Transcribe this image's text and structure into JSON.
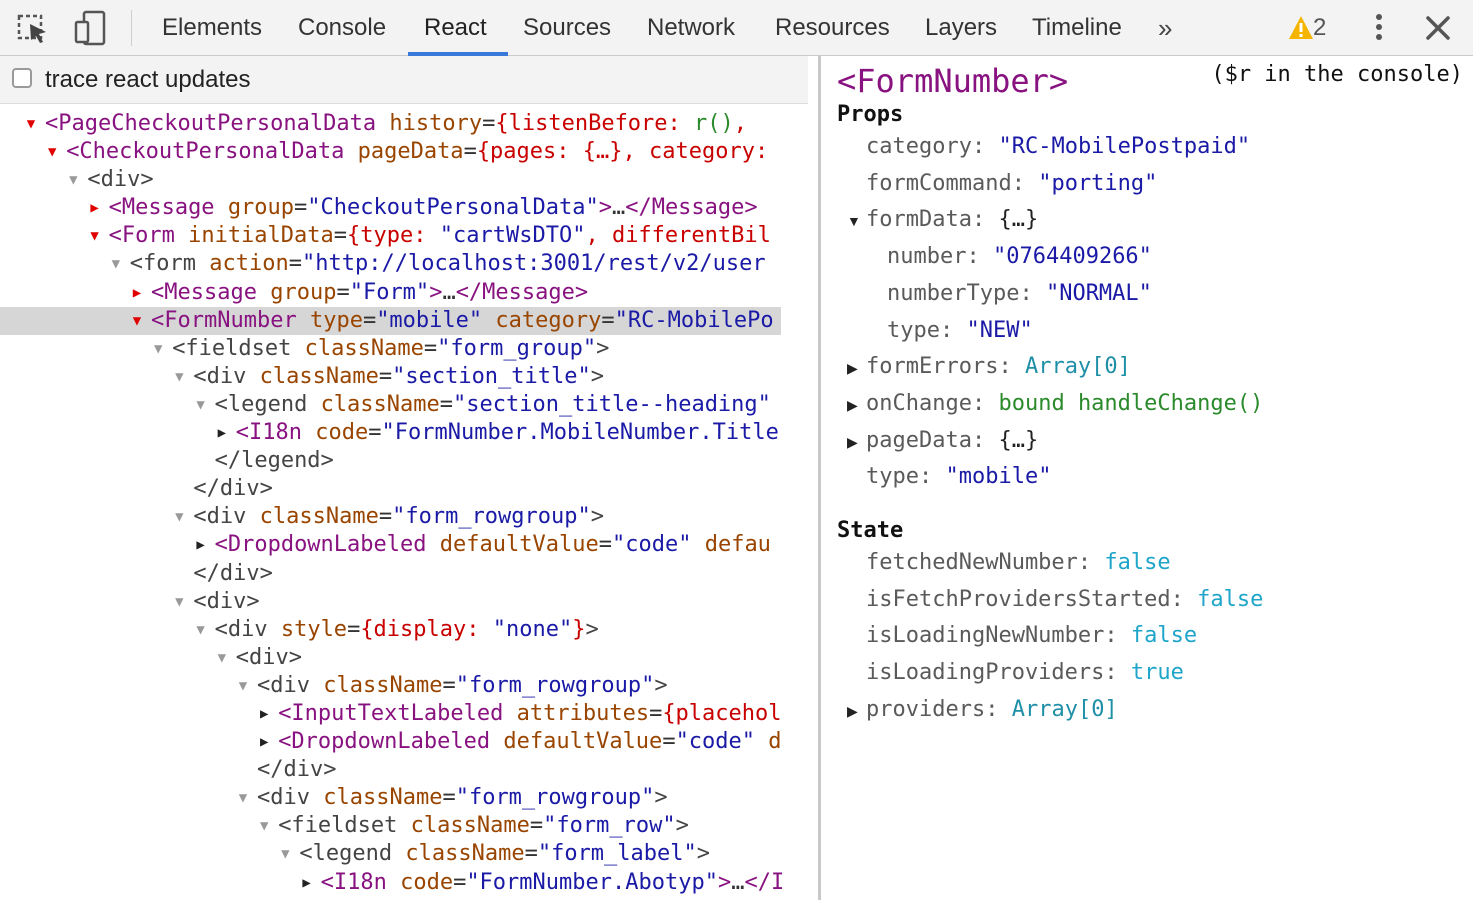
{
  "toolbar": {
    "tabs": [
      "Elements",
      "Console",
      "React",
      "Sources",
      "Network",
      "Resources",
      "Layers",
      "Timeline"
    ],
    "active_tab": "React",
    "more_tabs_glyph": "»",
    "warning_count": "2",
    "icons": [
      "inspect-element-icon",
      "device-mode-icon",
      "warning-icon",
      "kebab-menu-icon",
      "close-icon"
    ],
    "colors": {
      "active_underline": "#3879d9",
      "warning": "#f4b400"
    }
  },
  "left": {
    "trace_label": "trace react updates",
    "trace_checked": false,
    "tree": [
      {
        "indent": 0,
        "tri": "open",
        "parts": [
          [
            "tag",
            "<PageCheckoutPersonalData"
          ],
          [
            "tok",
            " "
          ],
          [
            "attr",
            "history"
          ],
          [
            "eq",
            "="
          ],
          [
            "obj",
            "{listenBefore: "
          ],
          [
            "func",
            "r()"
          ],
          [
            "obj",
            ", "
          ]
        ]
      },
      {
        "indent": 1,
        "tri": "open",
        "parts": [
          [
            "tag",
            "<CheckoutPersonalData"
          ],
          [
            "tok",
            " "
          ],
          [
            "attr",
            "pageData"
          ],
          [
            "eq",
            "="
          ],
          [
            "obj",
            "{pages: {…}, category:"
          ]
        ]
      },
      {
        "indent": 2,
        "tri": "open-grey",
        "parts": [
          [
            "tagplain",
            "<div>"
          ]
        ]
      },
      {
        "indent": 3,
        "tri": "closed",
        "parts": [
          [
            "tag",
            "<Message"
          ],
          [
            "tok",
            " "
          ],
          [
            "attr",
            "group"
          ],
          [
            "eq",
            "="
          ],
          [
            "str",
            "\"CheckoutPersonalData\""
          ],
          [
            "tag",
            ">"
          ],
          [
            "tok",
            "…"
          ],
          [
            "tag",
            "</Message>"
          ]
        ]
      },
      {
        "indent": 3,
        "tri": "open",
        "parts": [
          [
            "tag",
            "<Form"
          ],
          [
            "tok",
            " "
          ],
          [
            "attr",
            "initialData"
          ],
          [
            "eq",
            "="
          ],
          [
            "obj",
            "{type: "
          ],
          [
            "str",
            "\"cartWsDTO\""
          ],
          [
            "obj",
            ", differentBil"
          ]
        ]
      },
      {
        "indent": 4,
        "tri": "open-grey",
        "parts": [
          [
            "tagplain",
            "<form"
          ],
          [
            "tok",
            " "
          ],
          [
            "attr",
            "action"
          ],
          [
            "eq",
            "="
          ],
          [
            "str",
            "\"http://localhost:3001/rest/v2/user"
          ]
        ]
      },
      {
        "indent": 5,
        "tri": "closed",
        "parts": [
          [
            "tag",
            "<Message"
          ],
          [
            "tok",
            " "
          ],
          [
            "attr",
            "group"
          ],
          [
            "eq",
            "="
          ],
          [
            "str",
            "\"Form\""
          ],
          [
            "tag",
            ">"
          ],
          [
            "tok",
            "…"
          ],
          [
            "tag",
            "</Message>"
          ]
        ]
      },
      {
        "indent": 5,
        "tri": "open",
        "selected": true,
        "parts": [
          [
            "tag",
            "<FormNumber"
          ],
          [
            "tok",
            " "
          ],
          [
            "attr",
            "type"
          ],
          [
            "eq",
            "="
          ],
          [
            "str",
            "\"mobile\""
          ],
          [
            "tok",
            " "
          ],
          [
            "attr",
            "category"
          ],
          [
            "eq",
            "="
          ],
          [
            "str",
            "\"RC-MobilePo"
          ]
        ]
      },
      {
        "indent": 6,
        "tri": "open-grey",
        "parts": [
          [
            "tagplain",
            "<fieldset"
          ],
          [
            "tok",
            " "
          ],
          [
            "attr",
            "className"
          ],
          [
            "eq",
            "="
          ],
          [
            "str",
            "\"form_group\""
          ],
          [
            "tagplain",
            ">"
          ]
        ]
      },
      {
        "indent": 7,
        "tri": "open-grey",
        "parts": [
          [
            "tagplain",
            "<div"
          ],
          [
            "tok",
            " "
          ],
          [
            "attr",
            "className"
          ],
          [
            "eq",
            "="
          ],
          [
            "str",
            "\"section_title\""
          ],
          [
            "tagplain",
            ">"
          ]
        ]
      },
      {
        "indent": 8,
        "tri": "open-grey",
        "parts": [
          [
            "tagplain",
            "<legend"
          ],
          [
            "tok",
            " "
          ],
          [
            "attr",
            "className"
          ],
          [
            "eq",
            "="
          ],
          [
            "str",
            "\"section_title--heading\""
          ]
        ]
      },
      {
        "indent": 9,
        "tri": "closed",
        "parts": [
          [
            "tag",
            "<I18n"
          ],
          [
            "tok",
            " "
          ],
          [
            "attr",
            "code"
          ],
          [
            "eq",
            "="
          ],
          [
            "str",
            "\"FormNumber.MobileNumber.Title"
          ]
        ]
      },
      {
        "indent": 8,
        "tri": "none",
        "parts": [
          [
            "tagplain",
            "</legend>"
          ]
        ]
      },
      {
        "indent": 7,
        "tri": "none",
        "parts": [
          [
            "tagplain",
            "</div>"
          ]
        ]
      },
      {
        "indent": 7,
        "tri": "open-grey",
        "parts": [
          [
            "tagplain",
            "<div"
          ],
          [
            "tok",
            " "
          ],
          [
            "attr",
            "className"
          ],
          [
            "eq",
            "="
          ],
          [
            "str",
            "\"form_rowgroup\""
          ],
          [
            "tagplain",
            ">"
          ]
        ]
      },
      {
        "indent": 8,
        "tri": "closed",
        "parts": [
          [
            "tag",
            "<DropdownLabeled"
          ],
          [
            "tok",
            " "
          ],
          [
            "attr",
            "defaultValue"
          ],
          [
            "eq",
            "="
          ],
          [
            "str",
            "\"code\""
          ],
          [
            "tok",
            " "
          ],
          [
            "attr",
            "defau"
          ]
        ]
      },
      {
        "indent": 7,
        "tri": "none",
        "parts": [
          [
            "tagplain",
            "</div>"
          ]
        ]
      },
      {
        "indent": 7,
        "tri": "open-grey",
        "parts": [
          [
            "tagplain",
            "<div>"
          ]
        ]
      },
      {
        "indent": 8,
        "tri": "open-grey",
        "parts": [
          [
            "tagplain",
            "<div"
          ],
          [
            "tok",
            " "
          ],
          [
            "attr",
            "style"
          ],
          [
            "eq",
            "="
          ],
          [
            "obj",
            "{display: "
          ],
          [
            "str",
            "\"none\""
          ],
          [
            "obj",
            "}"
          ],
          [
            "tagplain",
            ">"
          ]
        ]
      },
      {
        "indent": 9,
        "tri": "open-grey",
        "parts": [
          [
            "tagplain",
            "<div>"
          ]
        ]
      },
      {
        "indent": 10,
        "tri": "open-grey",
        "parts": [
          [
            "tagplain",
            "<div"
          ],
          [
            "tok",
            " "
          ],
          [
            "attr",
            "className"
          ],
          [
            "eq",
            "="
          ],
          [
            "str",
            "\"form_rowgroup\""
          ],
          [
            "tagplain",
            ">"
          ]
        ]
      },
      {
        "indent": 11,
        "tri": "closed",
        "parts": [
          [
            "tag",
            "<InputTextLabeled"
          ],
          [
            "tok",
            " "
          ],
          [
            "attr",
            "attributes"
          ],
          [
            "eq",
            "="
          ],
          [
            "obj",
            "{placehol"
          ]
        ]
      },
      {
        "indent": 11,
        "tri": "closed",
        "parts": [
          [
            "tag",
            "<DropdownLabeled"
          ],
          [
            "tok",
            " "
          ],
          [
            "attr",
            "defaultValue"
          ],
          [
            "eq",
            "="
          ],
          [
            "str",
            "\"code\""
          ],
          [
            "tok",
            " "
          ],
          [
            "attr",
            "d"
          ]
        ]
      },
      {
        "indent": 10,
        "tri": "none",
        "parts": [
          [
            "tagplain",
            "</div>"
          ]
        ]
      },
      {
        "indent": 10,
        "tri": "open-grey",
        "parts": [
          [
            "tagplain",
            "<div"
          ],
          [
            "tok",
            " "
          ],
          [
            "attr",
            "className"
          ],
          [
            "eq",
            "="
          ],
          [
            "str",
            "\"form_rowgroup\""
          ],
          [
            "tagplain",
            ">"
          ]
        ]
      },
      {
        "indent": 11,
        "tri": "open-grey",
        "parts": [
          [
            "tagplain",
            "<fieldset"
          ],
          [
            "tok",
            " "
          ],
          [
            "attr",
            "className"
          ],
          [
            "eq",
            "="
          ],
          [
            "str",
            "\"form_row\""
          ],
          [
            "tagplain",
            ">"
          ]
        ]
      },
      {
        "indent": 12,
        "tri": "open-grey",
        "parts": [
          [
            "tagplain",
            "<legend"
          ],
          [
            "tok",
            " "
          ],
          [
            "attr",
            "className"
          ],
          [
            "eq",
            "="
          ],
          [
            "str",
            "\"form_label\""
          ],
          [
            "tagplain",
            ">"
          ]
        ]
      },
      {
        "indent": 13,
        "tri": "closed",
        "parts": [
          [
            "tag",
            "<I18n"
          ],
          [
            "tok",
            " "
          ],
          [
            "attr",
            "code"
          ],
          [
            "eq",
            "="
          ],
          [
            "str",
            "\"FormNumber.Abotyp\""
          ],
          [
            "tag",
            ">"
          ],
          [
            "tok",
            "…"
          ],
          [
            "tag",
            "</I"
          ]
        ]
      }
    ]
  },
  "right": {
    "component_title": "<FormNumber>",
    "console_hint": "($r in the console)",
    "props_heading": "Props",
    "state_heading": "State",
    "props": [
      {
        "key": "category",
        "value": "\"RC-MobilePostpaid\"",
        "kind": "str",
        "level": 0,
        "tri": "none"
      },
      {
        "key": "formCommand",
        "value": "\"porting\"",
        "kind": "str",
        "level": 0,
        "tri": "none"
      },
      {
        "key": "formData",
        "value": "{…}",
        "kind": "obj",
        "level": 0,
        "tri": "open"
      },
      {
        "key": "number",
        "value": "\"0764409266\"",
        "kind": "str",
        "level": 1,
        "tri": "none"
      },
      {
        "key": "numberType",
        "value": "\"NORMAL\"",
        "kind": "str",
        "level": 1,
        "tri": "none"
      },
      {
        "key": "type",
        "value": "\"NEW\"",
        "kind": "str",
        "level": 1,
        "tri": "none"
      },
      {
        "key": "formErrors",
        "value": "Array[0]",
        "kind": "arr",
        "level": 0,
        "tri": "closed"
      },
      {
        "key": "onChange",
        "value": "bound handleChange()",
        "kind": "func",
        "level": 0,
        "tri": "closed"
      },
      {
        "key": "pageData",
        "value": "{…}",
        "kind": "obj",
        "level": 0,
        "tri": "closed"
      },
      {
        "key": "type",
        "value": "\"mobile\"",
        "kind": "str",
        "level": 0,
        "tri": "none"
      }
    ],
    "state": [
      {
        "key": "fetchedNewNumber",
        "value": "false",
        "kind": "bool",
        "tri": "none"
      },
      {
        "key": "isFetchProvidersStarted",
        "value": "false",
        "kind": "bool",
        "tri": "none"
      },
      {
        "key": "isLoadingNewNumber",
        "value": "false",
        "kind": "bool",
        "tri": "none"
      },
      {
        "key": "isLoadingProviders",
        "value": "true",
        "kind": "bool",
        "tri": "none"
      },
      {
        "key": "providers",
        "value": "Array[0]",
        "kind": "arr",
        "tri": "closed"
      }
    ],
    "colors": {
      "tag": "#881280",
      "attr": "#994500",
      "string": "#1a1aa6",
      "bool": "#1ea5c9",
      "func": "#2b8a2b",
      "obj": "#c80000"
    }
  }
}
